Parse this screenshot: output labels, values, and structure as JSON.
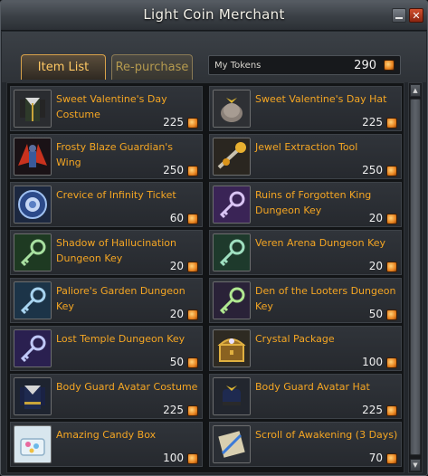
{
  "window": {
    "title": "Light Coin Merchant"
  },
  "tabs": [
    {
      "label": "Item List",
      "active": true
    },
    {
      "label": "Re-purchase",
      "active": false
    }
  ],
  "tokens": {
    "label": "My Tokens",
    "value": "290",
    "icon": "coin-icon"
  },
  "colors": {
    "item_name": "#f5a623",
    "tab_active_text": "#ffc864",
    "accent_border": "#d8a24a"
  },
  "items": [
    {
      "name": "Sweet Valentine's Day Costume",
      "price": "225",
      "icon": "costume-icon"
    },
    {
      "name": "Sweet Valentine's Day Hat",
      "price": "225",
      "icon": "hat-icon"
    },
    {
      "name": "Frosty Blaze Guardian's Wing",
      "price": "250",
      "icon": "wing-icon"
    },
    {
      "name": "Jewel Extraction Tool",
      "price": "250",
      "icon": "tool-icon"
    },
    {
      "name": "Crevice of Infinity Ticket",
      "price": "60",
      "icon": "ticket-icon"
    },
    {
      "name": "Ruins of Forgotten King Dungeon Key",
      "price": "20",
      "icon": "key-icon"
    },
    {
      "name": "Shadow of Hallucination Dungeon Key",
      "price": "20",
      "icon": "key-icon"
    },
    {
      "name": "Veren Arena Dungeon Key",
      "price": "20",
      "icon": "key-icon"
    },
    {
      "name": "Paliore's Garden Dungeon Key",
      "price": "20",
      "icon": "key-icon"
    },
    {
      "name": "Den of the Looters Dungeon Key",
      "price": "50",
      "icon": "key-icon"
    },
    {
      "name": "Lost Temple Dungeon Key",
      "price": "50",
      "icon": "key-icon"
    },
    {
      "name": "Crystal Package",
      "price": "100",
      "icon": "chest-icon"
    },
    {
      "name": "Body Guard Avatar Costume",
      "price": "225",
      "icon": "costume-icon"
    },
    {
      "name": "Body Guard Avatar Hat",
      "price": "225",
      "icon": "hat-icon"
    },
    {
      "name": "Amazing Candy Box",
      "price": "100",
      "icon": "candy-box-icon"
    },
    {
      "name": "Scroll of Awakening (3 Days)",
      "price": "70",
      "icon": "scroll-icon"
    }
  ]
}
